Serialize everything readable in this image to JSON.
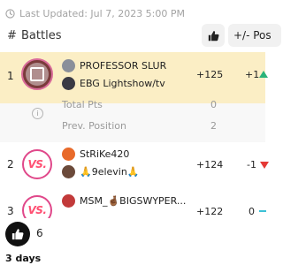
{
  "last_updated": "Last Updated: Jul 7, 2023 5:00 PM",
  "header": {
    "rank_symbol": "#",
    "battles_label": "Battles",
    "diff_label": "+/- Pos"
  },
  "battles": [
    {
      "rank": "1",
      "player1": "PROFESSOR SLUR",
      "player2": "EBG Lightshow/tv",
      "score": "+125",
      "diff": "+1",
      "diff_direction": "up",
      "highlight": true
    },
    {
      "rank": "2",
      "player1": "StRiKe420",
      "player2": "🙏9elevin🙏",
      "score": "+124",
      "diff": "-1",
      "diff_direction": "down",
      "highlight": false
    },
    {
      "rank": "3",
      "player1": "MSM_🤞🏾BIGSWYPER...",
      "player2": "",
      "score": "+122",
      "diff": "0",
      "diff_direction": "none",
      "highlight": false
    }
  ],
  "details": {
    "total_pts_label": "Total Pts",
    "total_pts_value": "0",
    "prev_position_label": "Prev. Position",
    "prev_position_value": "2"
  },
  "reactions": {
    "like_count": "6",
    "time_ago": "3 days"
  },
  "colors": {
    "highlight_row": "#fbeec5",
    "up": "#2ab37a",
    "down": "#e53935",
    "vs_pink": "#ff4f72"
  },
  "icons": {
    "clock": "clock-icon",
    "thumb": "thumbs-up-icon",
    "info": "info-icon",
    "vs": "vs-badge-icon"
  }
}
